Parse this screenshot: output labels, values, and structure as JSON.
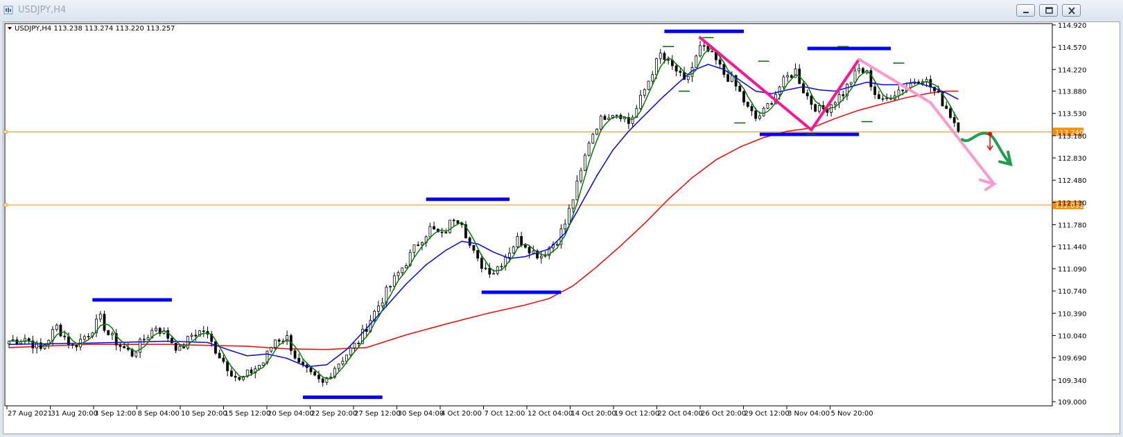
{
  "window": {
    "title": "USDJPY,H4",
    "controls": [
      "minimize-icon",
      "restore-icon",
      "close-icon"
    ]
  },
  "chart_data": {
    "type": "candlestick",
    "symbol_line": "USDJPY,H4  113.238 113.274 113.220 113.257",
    "y_ticks": [
      "114.920",
      "114.570",
      "114.220",
      "113.880",
      "113.530",
      "113.180",
      "112.830",
      "112.480",
      "112.130",
      "111.780",
      "111.440",
      "111.090",
      "110.740",
      "110.390",
      "110.040",
      "109.690",
      "109.340",
      "109.000"
    ],
    "ylim": [
      109.0,
      114.92
    ],
    "x_ticks": [
      "27 Aug 2021",
      "31 Aug 20:00",
      "3 Sep 12:00",
      "8 Sep 04:00",
      "10 Sep 20:00",
      "15 Sep 12:00",
      "20 Sep 04:00",
      "22 Sep 20:00",
      "27 Sep 12:00",
      "30 Sep 04:00",
      "4 Oct 20:00",
      "7 Oct 12:00",
      "12 Oct 04:00",
      "14 Oct 20:00",
      "19 Oct 12:00",
      "22 Oct 04:00",
      "26 Oct 20:00",
      "29 Oct 12:00",
      "3 Nov 04:00",
      "5 Nov 20:00"
    ],
    "price_path": [
      [
        0,
        109.95
      ],
      [
        4,
        110.0
      ],
      [
        8,
        109.82
      ],
      [
        12,
        110.18
      ],
      [
        14,
        110.02
      ],
      [
        16,
        109.86
      ],
      [
        20,
        110.08
      ],
      [
        23,
        110.3
      ],
      [
        25,
        110.06
      ],
      [
        28,
        109.88
      ],
      [
        31,
        109.75
      ],
      [
        34,
        109.98
      ],
      [
        37,
        110.18
      ],
      [
        40,
        110.02
      ],
      [
        43,
        109.8
      ],
      [
        46,
        110.05
      ],
      [
        49,
        110.12
      ],
      [
        52,
        109.82
      ],
      [
        55,
        109.55
      ],
      [
        58,
        109.32
      ],
      [
        61,
        109.48
      ],
      [
        64,
        109.62
      ],
      [
        67,
        109.98
      ],
      [
        70,
        110.0
      ],
      [
        73,
        109.58
      ],
      [
        76,
        109.4
      ],
      [
        79,
        109.28
      ],
      [
        82,
        109.55
      ],
      [
        85,
        109.75
      ],
      [
        88,
        109.95
      ],
      [
        91,
        110.3
      ],
      [
        94,
        110.62
      ],
      [
        97,
        110.92
      ],
      [
        100,
        111.2
      ],
      [
        103,
        111.5
      ],
      [
        106,
        111.72
      ],
      [
        109,
        111.6
      ],
      [
        112,
        111.9
      ],
      [
        114,
        111.85
      ],
      [
        116,
        111.45
      ],
      [
        118,
        111.2
      ],
      [
        120,
        111.1
      ],
      [
        122,
        111.05
      ],
      [
        124,
        111.2
      ],
      [
        126,
        111.38
      ],
      [
        128,
        111.55
      ],
      [
        130,
        111.48
      ],
      [
        132,
        111.35
      ],
      [
        134,
        111.3
      ],
      [
        136,
        111.42
      ],
      [
        138,
        111.55
      ],
      [
        140,
        111.8
      ],
      [
        142,
        112.2
      ],
      [
        144,
        112.6
      ],
      [
        146,
        113.1
      ],
      [
        148,
        113.35
      ],
      [
        150,
        113.5
      ],
      [
        152,
        113.55
      ],
      [
        154,
        113.52
      ],
      [
        156,
        113.38
      ],
      [
        158,
        113.6
      ],
      [
        160,
        113.9
      ],
      [
        162,
        114.2
      ],
      [
        164,
        114.45
      ],
      [
        166,
        114.3
      ],
      [
        168,
        114.2
      ],
      [
        170,
        114.0
      ],
      [
        172,
        114.25
      ],
      [
        174,
        114.55
      ],
      [
        176,
        114.5
      ],
      [
        178,
        114.35
      ],
      [
        180,
        114.15
      ],
      [
        182,
        114.05
      ],
      [
        184,
        113.85
      ],
      [
        186,
        113.6
      ],
      [
        188,
        113.45
      ],
      [
        190,
        113.55
      ],
      [
        192,
        113.75
      ],
      [
        194,
        113.95
      ],
      [
        196,
        114.1
      ],
      [
        198,
        114.2
      ],
      [
        200,
        113.9
      ],
      [
        202,
        113.7
      ],
      [
        204,
        113.58
      ],
      [
        206,
        113.62
      ],
      [
        208,
        113.75
      ],
      [
        210,
        113.85
      ],
      [
        212,
        114.05
      ],
      [
        214,
        114.22
      ],
      [
        216,
        114.15
      ],
      [
        218,
        113.85
      ],
      [
        220,
        113.7
      ],
      [
        222,
        113.82
      ],
      [
        224,
        113.9
      ],
      [
        226,
        113.95
      ],
      [
        228,
        114.05
      ],
      [
        230,
        114.1
      ],
      [
        232,
        113.95
      ],
      [
        234,
        113.8
      ],
      [
        236,
        113.62
      ],
      [
        238,
        113.4
      ],
      [
        240,
        113.25
      ]
    ],
    "ma_fast_color": "#007a00",
    "ma_mid_color": "#0000ff",
    "ma_slow_color": "#ff0000",
    "ma_slow_path": [
      [
        0,
        109.85
      ],
      [
        20,
        109.9
      ],
      [
        40,
        109.9
      ],
      [
        60,
        109.87
      ],
      [
        70,
        109.83
      ],
      [
        80,
        109.82
      ],
      [
        90,
        109.85
      ],
      [
        100,
        110.05
      ],
      [
        110,
        110.22
      ],
      [
        120,
        110.38
      ],
      [
        130,
        110.52
      ],
      [
        136,
        110.62
      ],
      [
        142,
        110.82
      ],
      [
        148,
        111.12
      ],
      [
        154,
        111.45
      ],
      [
        160,
        111.8
      ],
      [
        166,
        112.18
      ],
      [
        172,
        112.52
      ],
      [
        178,
        112.8
      ],
      [
        184,
        113.0
      ],
      [
        190,
        113.15
      ],
      [
        196,
        113.25
      ],
      [
        202,
        113.3
      ],
      [
        208,
        113.45
      ],
      [
        214,
        113.58
      ],
      [
        220,
        113.68
      ],
      [
        226,
        113.78
      ],
      [
        232,
        113.85
      ],
      [
        236,
        113.88
      ],
      [
        240,
        113.88
      ]
    ],
    "ma_mid_path": [
      [
        0,
        109.9
      ],
      [
        20,
        109.92
      ],
      [
        40,
        109.95
      ],
      [
        50,
        109.93
      ],
      [
        55,
        109.82
      ],
      [
        60,
        109.72
      ],
      [
        65,
        109.75
      ],
      [
        70,
        109.68
      ],
      [
        75,
        109.55
      ],
      [
        80,
        109.58
      ],
      [
        85,
        109.82
      ],
      [
        90,
        110.15
      ],
      [
        95,
        110.5
      ],
      [
        100,
        110.85
      ],
      [
        105,
        111.15
      ],
      [
        110,
        111.38
      ],
      [
        114,
        111.52
      ],
      [
        118,
        111.48
      ],
      [
        122,
        111.35
      ],
      [
        126,
        111.25
      ],
      [
        130,
        111.28
      ],
      [
        136,
        111.4
      ],
      [
        140,
        111.65
      ],
      [
        144,
        112.1
      ],
      [
        148,
        112.55
      ],
      [
        152,
        112.95
      ],
      [
        156,
        113.25
      ],
      [
        160,
        113.5
      ],
      [
        164,
        113.75
      ],
      [
        168,
        113.98
      ],
      [
        172,
        114.2
      ],
      [
        176,
        114.3
      ],
      [
        180,
        114.22
      ],
      [
        184,
        114.05
      ],
      [
        188,
        113.88
      ],
      [
        192,
        113.84
      ],
      [
        196,
        113.9
      ],
      [
        200,
        113.95
      ],
      [
        204,
        113.9
      ],
      [
        208,
        113.88
      ],
      [
        212,
        113.95
      ],
      [
        216,
        114.02
      ],
      [
        220,
        113.98
      ],
      [
        224,
        113.98
      ],
      [
        228,
        114.02
      ],
      [
        232,
        113.95
      ],
      [
        236,
        113.85
      ],
      [
        240,
        113.72
      ]
    ],
    "horizontal_levels": [
      {
        "value": "113.240",
        "color": "#ff8c00"
      },
      {
        "value": "112.091",
        "color": "#ff8c00"
      }
    ],
    "annotations": [
      {
        "type": "resistance",
        "color": "#0000ff",
        "x0": 21,
        "x1": 41,
        "y": 110.6
      },
      {
        "type": "support",
        "color": "#0000ff",
        "x0": 74,
        "x1": 94,
        "y": 109.07
      },
      {
        "type": "resistance",
        "color": "#0000ff",
        "x0": 105,
        "x1": 126,
        "y": 112.18
      },
      {
        "type": "support",
        "color": "#0000ff",
        "x0": 119,
        "x1": 139,
        "y": 110.72
      },
      {
        "type": "resistance",
        "color": "#0000ff",
        "x0": 165,
        "x1": 185,
        "y": 114.82
      },
      {
        "type": "support",
        "color": "#0000ff",
        "x0": 189,
        "x1": 214,
        "y": 113.2
      },
      {
        "type": "resistance",
        "color": "#0000ff",
        "x0": 201,
        "x1": 222,
        "y": 114.55
      }
    ],
    "pattern_lines": [
      {
        "color": "#ff1493",
        "points": [
          [
            174,
            114.72
          ],
          [
            202,
            113.27
          ],
          [
            214,
            114.38
          ]
        ]
      },
      {
        "color": "#ff99cc",
        "points": [
          [
            214,
            114.38
          ],
          [
            232,
            113.7
          ],
          [
            248,
            112.42
          ]
        ]
      }
    ],
    "forecast": {
      "green_color": "#1e9e4f",
      "red_color": "#ff0000"
    }
  }
}
